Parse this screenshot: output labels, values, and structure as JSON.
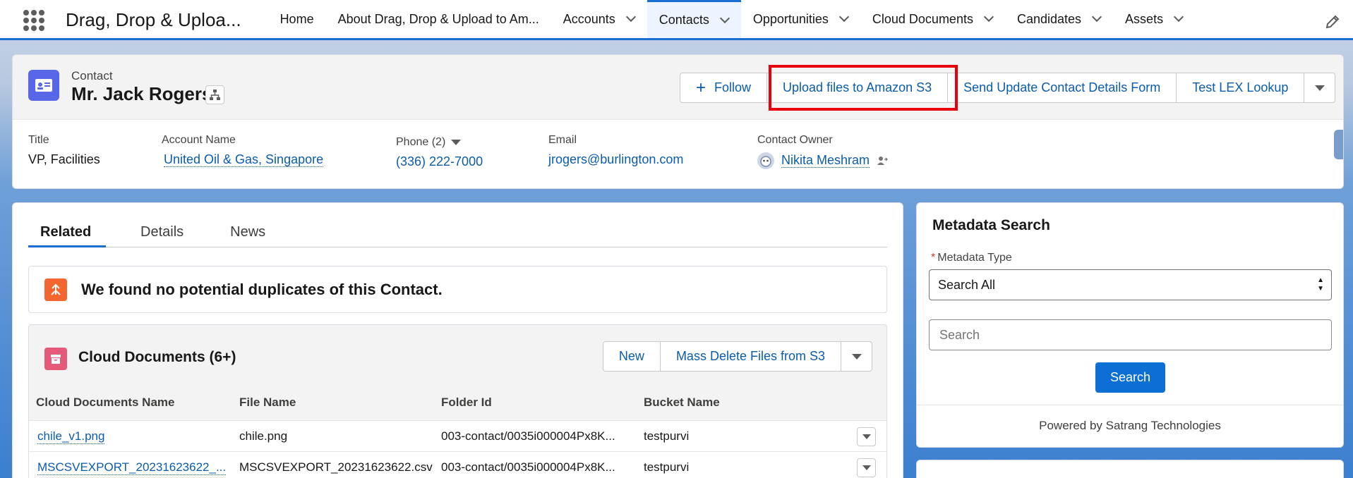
{
  "app": {
    "name": "Drag, Drop & Uploa..."
  },
  "nav": {
    "items": [
      {
        "label": "Home",
        "has_menu": false
      },
      {
        "label": "About Drag, Drop & Upload to Am...",
        "has_menu": false
      },
      {
        "label": "Accounts",
        "has_menu": true
      },
      {
        "label": "Contacts",
        "has_menu": true,
        "active": true
      },
      {
        "label": "Opportunities",
        "has_menu": true
      },
      {
        "label": "Cloud Documents",
        "has_menu": true
      },
      {
        "label": "Candidates",
        "has_menu": true
      },
      {
        "label": "Assets",
        "has_menu": true
      }
    ]
  },
  "header": {
    "record_type": "Contact",
    "record_name": "Mr. Jack Rogers",
    "actions": {
      "follow": "Follow",
      "upload": "Upload files to Amazon S3",
      "send_form": "Send Update Contact Details Form",
      "lex_lookup": "Test LEX Lookup"
    },
    "fields": {
      "title_label": "Title",
      "title_value": "VP, Facilities",
      "account_label": "Account Name",
      "account_value": "United Oil & Gas, Singapore",
      "phone_label": "Phone (2)",
      "phone_value": "(336) 222-7000",
      "email_label": "Email",
      "email_value": "jrogers@burlington.com",
      "owner_label": "Contact Owner",
      "owner_value": "Nikita Meshram"
    }
  },
  "tabs": {
    "related": "Related",
    "details": "Details",
    "news": "News"
  },
  "duplicates": {
    "message": "We found no potential duplicates of this Contact."
  },
  "cloud_docs": {
    "title": "Cloud Documents (6+)",
    "new_label": "New",
    "mass_delete_label": "Mass Delete Files from S3",
    "columns": [
      "Cloud Documents Name",
      "File Name",
      "Folder Id",
      "Bucket Name"
    ],
    "rows": [
      {
        "name": "chile_v1.png",
        "file": "chile.png",
        "folder": "003-contact/0035i000004Px8K...",
        "bucket": "testpurvi"
      },
      {
        "name": "MSCSVEXPORT_20231623622_...",
        "file": "MSCSVEXPORT_20231623622.csv",
        "folder": "003-contact/0035i000004Px8K...",
        "bucket": "testpurvi"
      }
    ]
  },
  "metadata_search": {
    "title": "Metadata Search",
    "type_label": "Metadata Type",
    "type_value": "Search All",
    "search_placeholder": "Search",
    "search_button": "Search",
    "powered_by": "Powered by Satrang Technologies"
  },
  "colors": {
    "brand_blue": "#1b6fd3",
    "link": "#0b5cab",
    "highlight": "#e8000d"
  }
}
